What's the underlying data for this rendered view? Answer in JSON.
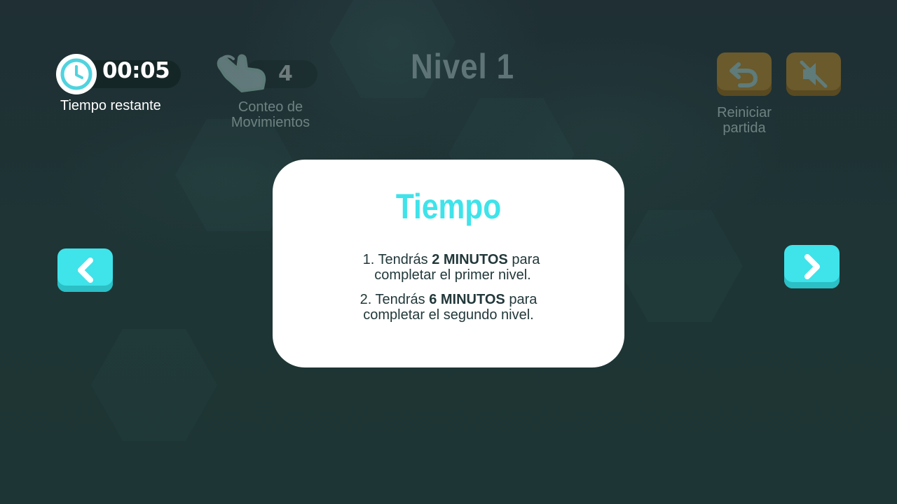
{
  "timer": {
    "value": "00:05",
    "label": "Tiempo restante",
    "icon": "clock-icon"
  },
  "moves": {
    "value": "4",
    "label_line1": "Conteo de",
    "label_line2": "Movimientos",
    "icon": "hand-tap-icon"
  },
  "level": {
    "title": "Nivel 1"
  },
  "controls": {
    "restart_label_line1": "Reiniciar",
    "restart_label_line2": "partida",
    "restart_icon": "undo-icon",
    "mute_icon": "speaker-muted-icon"
  },
  "modal": {
    "title": "Tiempo",
    "rule1": {
      "prefix": "1. Tendrás ",
      "bold": "2 MINUTOS",
      "suffix": " para",
      "line2": "completar el primer nivel."
    },
    "rule2": {
      "prefix": "2. Tendrás ",
      "bold": "6 MINUTOS",
      "suffix": " para",
      "line2": "completar el segundo nivel."
    }
  },
  "navigation": {
    "prev_icon": "chevron-left-icon",
    "next_icon": "chevron-right-icon"
  },
  "colors": {
    "accent": "#3fe3ea",
    "modal_bg": "#ffffff",
    "background": "#1e3434",
    "muted_button": "#6a5a2c"
  }
}
